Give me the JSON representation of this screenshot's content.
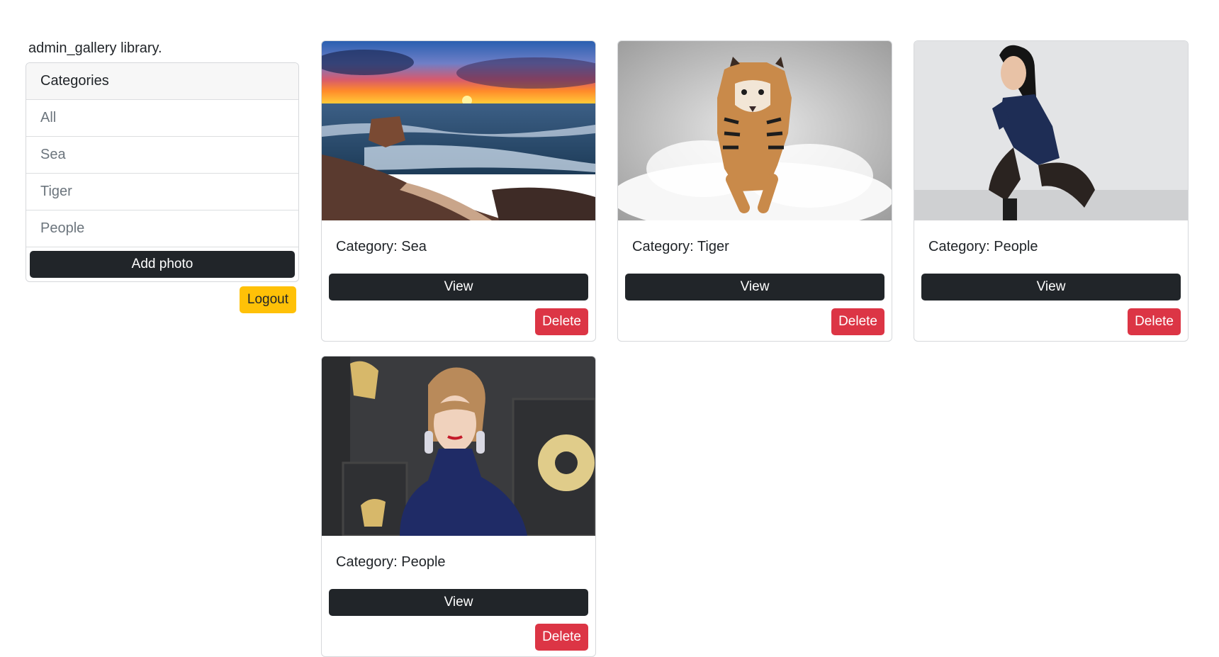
{
  "sidebar": {
    "greeting": "admin_gallery library.",
    "header": "Categories",
    "categories": [
      "All",
      "Sea",
      "Tiger",
      "People"
    ],
    "add_photo_label": "Add photo",
    "logout_label": "Logout"
  },
  "cards": [
    {
      "category_text": "Category: Sea",
      "view_label": "View",
      "delete_label": "Delete"
    },
    {
      "category_text": "Category: Tiger",
      "view_label": "View",
      "delete_label": "Delete"
    },
    {
      "category_text": "Category: People",
      "view_label": "View",
      "delete_label": "Delete"
    },
    {
      "category_text": "Category: People",
      "view_label": "View",
      "delete_label": "Delete"
    }
  ],
  "colors": {
    "primary_dark": "#212529",
    "danger": "#dc3545",
    "warning": "#ffc107"
  }
}
